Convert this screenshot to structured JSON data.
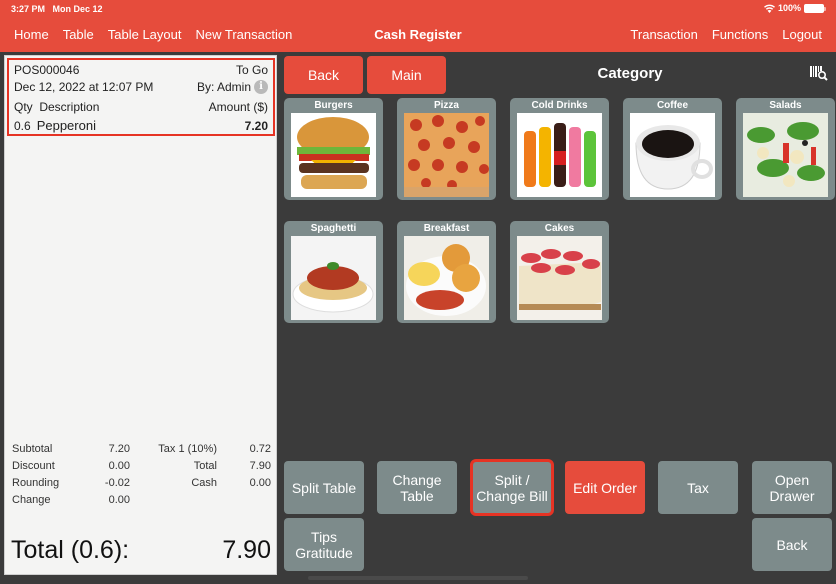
{
  "status_bar": {
    "time": "3:27 PM",
    "date": "Mon Dec 12",
    "battery": "100%"
  },
  "nav": {
    "left": [
      "Home",
      "Table",
      "Table Layout",
      "New Transaction"
    ],
    "title": "Cash Register",
    "right": [
      "Transaction",
      "Functions",
      "Logout"
    ]
  },
  "receipt": {
    "order_no": "POS000046",
    "order_type": "To Go",
    "datetime": "Dec 12, 2022 at 12:07 PM",
    "by": "By: Admin",
    "headers": {
      "qty": "Qty",
      "description": "Description",
      "amount": "Amount ($)"
    },
    "items": [
      {
        "qty": "0.6",
        "description": "Pepperoni",
        "amount": "7.20"
      }
    ],
    "totals": [
      {
        "l1": "Subtotal",
        "v1": "7.20",
        "l2": "Tax 1 (10%)",
        "v2": "0.72"
      },
      {
        "l1": "Discount",
        "v1": "0.00",
        "l2": "Total",
        "v2": "7.90"
      },
      {
        "l1": "Rounding",
        "v1": "-0.02",
        "l2": "Cash",
        "v2": "0.00"
      },
      {
        "l1": "Change",
        "v1": "0.00",
        "l2": "",
        "v2": ""
      }
    ],
    "grand_total_label": "Total (0.6):",
    "grand_total_value": "7.90"
  },
  "toolbar": {
    "back": "Back",
    "main": "Main",
    "title": "Category"
  },
  "categories": [
    {
      "label": "Burgers"
    },
    {
      "label": "Pizza"
    },
    {
      "label": "Cold Drinks"
    },
    {
      "label": "Coffee"
    },
    {
      "label": "Salads"
    },
    {
      "label": "Spaghetti"
    },
    {
      "label": "Breakfast"
    },
    {
      "label": "Cakes"
    }
  ],
  "actions": {
    "split_table": "Split Table",
    "change_table": "Change\nTable",
    "split_change_bill": "Split /\nChange Bill",
    "edit_order": "Edit Order",
    "tax": "Tax",
    "open_drawer": "Open\nDrawer",
    "tips_gratitude": "Tips\nGratitude",
    "back": "Back"
  },
  "colors": {
    "brand_red": "#e64c3c",
    "tile_gray": "#7d8b8b",
    "highlight": "#e63324",
    "background": "#3b3b3b"
  }
}
